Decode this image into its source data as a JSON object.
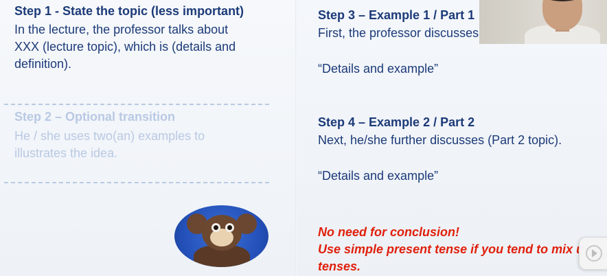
{
  "step1": {
    "heading": "Step 1 - State the topic (less important)",
    "lines": [
      "In the lecture, the professor talks about",
      "XXX (lecture topic), which is (details and",
      "definition)."
    ]
  },
  "step2": {
    "heading": "Step 2 – Optional transition",
    "lines": [
      "He / she uses two(an) examples to",
      "illustrates the idea."
    ]
  },
  "step3": {
    "heading": "Step 3 – Example 1 / Part 1",
    "line": "First, the professor discusses",
    "detail": "“Details and example”"
  },
  "step4": {
    "heading": "Step 4 – Example 2 / Part 2",
    "line": "Next, he/she further discusses (Part 2 topic).",
    "detail": "“Details and example”"
  },
  "notes": [
    "No need for conclusion!",
    "Use simple present tense if you tend to mix up",
    "tenses."
  ],
  "colors": {
    "heading": "#1c3a78",
    "faded": "#b9c9e4",
    "accent_red": "#e0200c"
  },
  "icons": {
    "floating": "play-circle-icon"
  }
}
